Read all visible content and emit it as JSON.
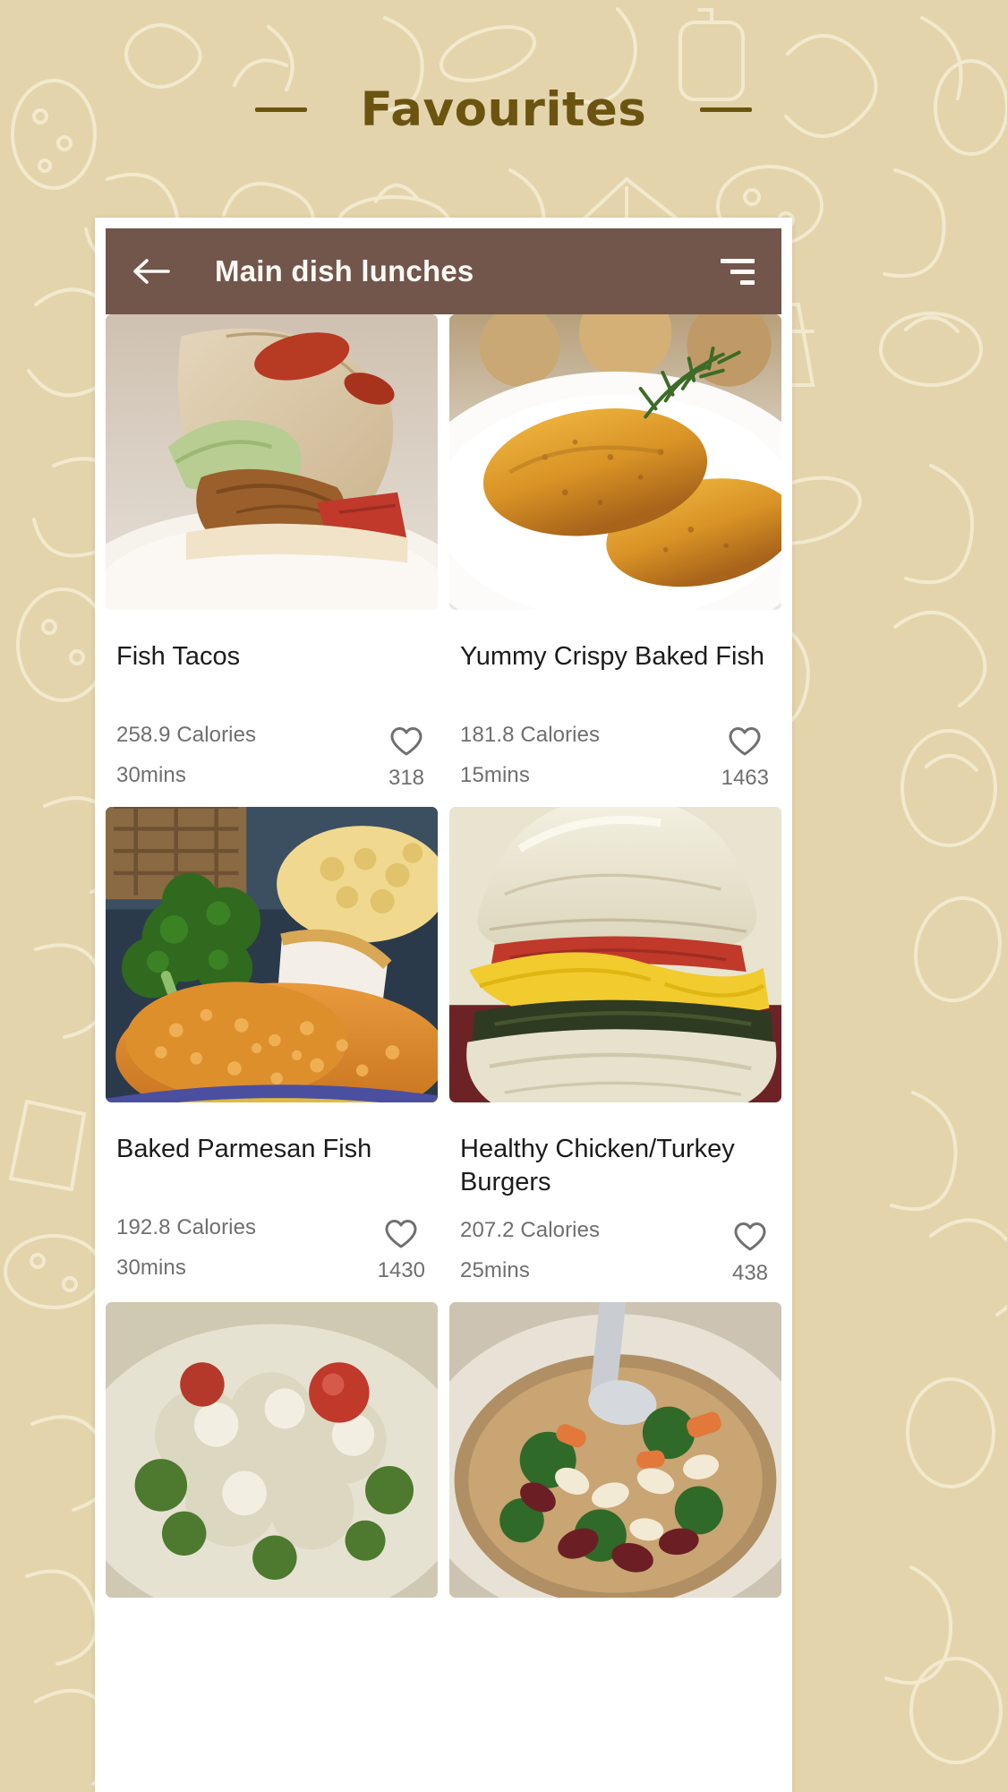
{
  "page": {
    "title": "Favourites",
    "background_color": "#e3d4ac",
    "title_color": "#6b5410"
  },
  "app_bar": {
    "title": "Main dish lunches",
    "background_color": "#72554b",
    "text_color": "#fdfaf5",
    "back_icon": "arrow-left-icon",
    "sort_icon": "sort-lines-icon"
  },
  "labels": {
    "calories_suffix": "Calories",
    "heart_icon": "heart-outline-icon"
  },
  "recipes": [
    {
      "name": "Fish Tacos",
      "calories": "258.9 Calories",
      "time": "30mins",
      "favourites": "318",
      "image_alt": "fish-taco-on-white-plate"
    },
    {
      "name": "Yummy Crispy Baked Fish",
      "calories": "181.8 Calories",
      "time": "15mins",
      "favourites": "1463",
      "image_alt": "crispy-baked-fish-fillets-with-thyme"
    },
    {
      "name": "Baked Parmesan Fish",
      "calories": "192.8 Calories",
      "time": "30mins",
      "favourites": "1430",
      "image_alt": "baked-parmesan-fish-with-broccoli-and-macaroni"
    },
    {
      "name": "Healthy Chicken/Turkey Burgers",
      "calories": "207.2 Calories",
      "time": "25mins",
      "favourites": "438",
      "image_alt": "burger-with-cheese-and-tomato"
    },
    {
      "name": "",
      "calories": "",
      "time": "",
      "favourites": "",
      "image_alt": "chicken-salad-with-tomato"
    },
    {
      "name": "",
      "calories": "",
      "time": "",
      "favourites": "",
      "image_alt": "bean-and-kale-soup-with-spoon"
    }
  ]
}
